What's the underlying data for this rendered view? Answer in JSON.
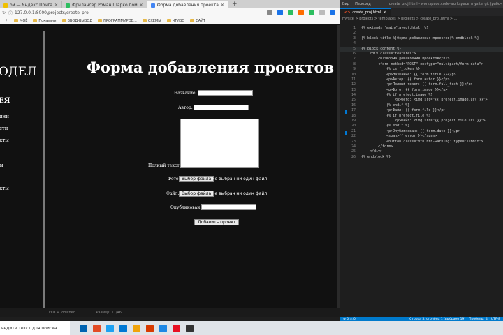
{
  "browser": {
    "tabs": [
      {
        "label": "ой — Яндекс.Почта",
        "color": "#f0c000"
      },
      {
        "label": "Фриланcер Роман Шарко пом",
        "color": "#2dbe60"
      },
      {
        "label": "Форма добавления проекта",
        "color": "#4285f4"
      }
    ],
    "url": "127.0.0.1:8000/projects/create_proj",
    "bookmarks": [
      "МОЁ",
      "Показали",
      "ВВОД-ВЫВОД",
      "ПРОГРАММИРОВ...",
      "СХЕМЫ",
      "ЧТИВО",
      "САЙТ"
    ]
  },
  "page": {
    "brand": "ОДЕЛ",
    "sidebar_heading": "ЕЯ",
    "sidebar_links": [
      "ини",
      "сти",
      "кты",
      "ы",
      "кты"
    ],
    "title": "Форма добавления проектов",
    "form": {
      "name_label": "Название:",
      "author_label": "Автор:",
      "fulltext_label": "Полный текст:",
      "photo_label": "Фото:",
      "file_label": "Файл:",
      "published_label": "Опубликован:",
      "choose_file": "Выбор файла",
      "no_file": "Не выбран ни один файл",
      "submit": "Добавить проект"
    }
  },
  "bottom_strip": [
    "FOX • Toolchec",
    "Размер: 11/46"
  ],
  "vscode": {
    "menu": [
      "Вид",
      "Переход"
    ],
    "window_title": "create_proj.html - workspace.code-workspace_mysite_git (рабоч",
    "tab": "create_proj.html",
    "breadcrumb": "mysite > projects > templates > projects > create_proj.html > ...",
    "lines": [
      {
        "n": "1",
        "t": "{% extends 'main/layout.html' %}"
      },
      {
        "n": "2",
        "t": ""
      },
      {
        "n": "3",
        "t": "{% block title %}Форма добавления проектов{% endblock %}"
      },
      {
        "n": "4",
        "t": ""
      },
      {
        "n": "5",
        "t": "{% block content %}"
      },
      {
        "n": "6",
        "t": "    <div class=\"features\">"
      },
      {
        "n": "7",
        "t": "        <h1>Форма добавления проектов</h1>"
      },
      {
        "n": "8",
        "t": "        <form method=\"POST\" enctype=\"multipart/form-data\">"
      },
      {
        "n": "9",
        "t": "            {% csrf_token %}"
      },
      {
        "n": "10",
        "t": "            <p>Название: {{ form.title }}</p>"
      },
      {
        "n": "11",
        "t": "            <p>Автор: {{ form.autor }}</p>"
      },
      {
        "n": "12",
        "t": "            <p>Полный текст: {{ form.full_text }}</p>"
      },
      {
        "n": "13",
        "t": "            <p>Фото: {{ form.image }}</p>"
      },
      {
        "n": "14",
        "t": "            {% if project.image %}"
      },
      {
        "n": "15",
        "t": "                <p>Фото: <img src=\"{{ project.image.url }}\">"
      },
      {
        "n": "16",
        "t": "            {% endif %}"
      },
      {
        "n": "17",
        "t": "            <p>Файл: {{ form.file }}</p>"
      },
      {
        "n": "18",
        "t": "            {% if project.file %}"
      },
      {
        "n": "19",
        "t": "                <p>Файл: <img src=\"{{ project.file.url }}\">"
      },
      {
        "n": "20",
        "t": "            {% endif %}"
      },
      {
        "n": "21",
        "t": "            <p>Опубликован: {{ form.date }}</p>"
      },
      {
        "n": "22",
        "t": "            <span>{{ error }}</span>"
      },
      {
        "n": "23",
        "t": "            <button class=\"btn btn-warning\" type=\"submit\">"
      },
      {
        "n": "24",
        "t": "        </form>"
      },
      {
        "n": "25",
        "t": "    </div>"
      },
      {
        "n": "26",
        "t": "{% endblock %}"
      }
    ],
    "status_left": "⊗ 0 ⚠ 0",
    "status_right": [
      "Строка 5, столбец 1 (выбрано 19)",
      "Пробелы: 4",
      "UTF-8"
    ]
  },
  "taskbar": {
    "search_placeholder": "ведите текст для поиска",
    "icon_colors": [
      "#0063b1",
      "#e34c26",
      "#1da1f2",
      "#0078d4",
      "#f0a30a",
      "#d83b01",
      "#1e88e5",
      "#e81123",
      "#333333"
    ]
  }
}
